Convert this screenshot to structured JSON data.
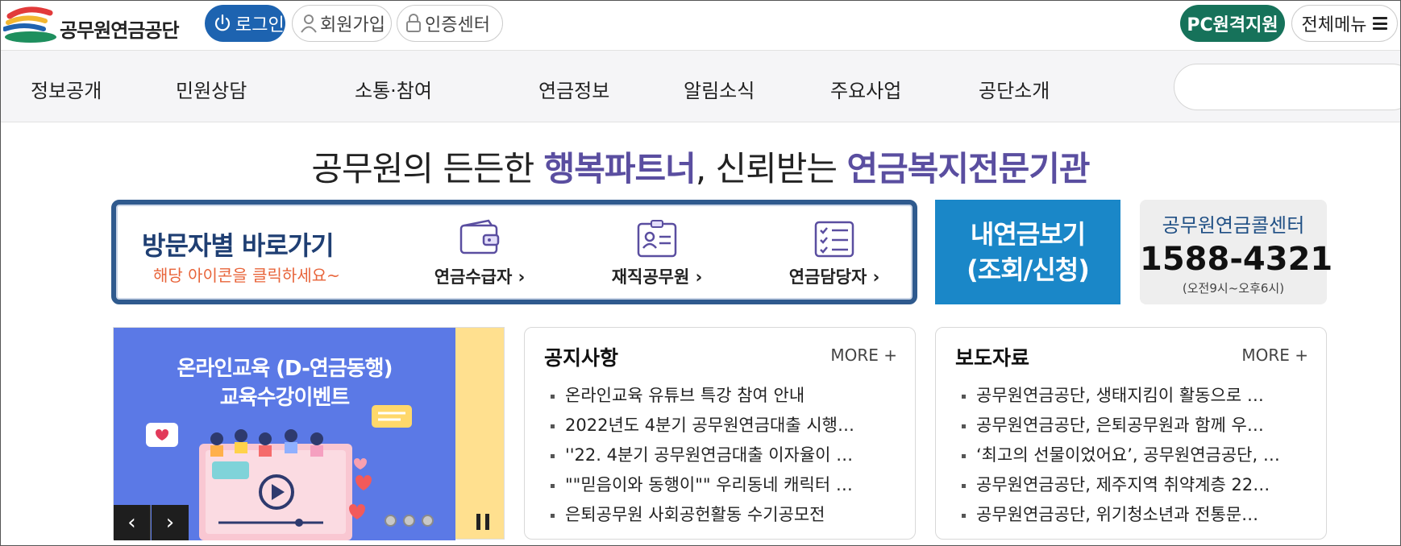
{
  "header": {
    "logo_text": "공무원연금공단",
    "login_label": "로그인",
    "join_label": "회원가입",
    "cert_label": "인증센터",
    "pc_support_label": "PC원격지원",
    "all_menu_label": "전체메뉴"
  },
  "nav": {
    "items": [
      {
        "label": "정보공개"
      },
      {
        "label": "민원상담"
      },
      {
        "label": "소통·참여"
      },
      {
        "label": "연금정보"
      },
      {
        "label": "알림소식"
      },
      {
        "label": "주요사업"
      },
      {
        "label": "공단소개"
      }
    ]
  },
  "slogan": {
    "part1": "공무원의 든든한 ",
    "highlight1": "행복파트너",
    "part2": ", 신뢰받는 ",
    "highlight2": "연금복지전문기관"
  },
  "visitor": {
    "title": "방문자별 바로가기",
    "subtitle": "해당 아이콘을 클릭하세요~",
    "links": [
      {
        "label": "연금수급자",
        "icon": "wallet-icon"
      },
      {
        "label": "재직공무원",
        "icon": "id-card-icon"
      },
      {
        "label": "연금담당자",
        "icon": "checklist-icon"
      }
    ]
  },
  "my_pension": {
    "line1": "내연금보기",
    "line2": "(조회/신청)"
  },
  "call_center": {
    "title": "공무원연금콜센터",
    "number": "1588-4321",
    "hours": "(오전9시~오후6시)"
  },
  "banner": {
    "line1": "온라인교육 (D-연금동행)",
    "line2": "교육수강이벤트",
    "prev_label": "‹",
    "next_label": "›",
    "slide_count": 3
  },
  "notices": {
    "title": "공지사항",
    "more_label": "MORE +",
    "items": [
      "온라인교육 유튜브 특강 참여 안내",
      "2022년도 4분기 공무원연금대출 시행…",
      "''22. 4분기 공무원연금대출 이자율이 …",
      "\"\"믿음이와 동행이\"\" 우리동네 캐릭터 …",
      "은퇴공무원 사회공헌활동 수기공모전"
    ]
  },
  "press": {
    "title": "보도자료",
    "more_label": "MORE +",
    "items": [
      "공무원연금공단, 생태지킴이 활동으로 …",
      "공무원연금공단, 은퇴공무원과 함께 우…",
      "‘최고의 선물이었어요’, 공무원연금공단, …",
      "공무원연금공단, 제주지역 취약계층 22…",
      "공무원연금공단, 위기청소년과 전통문…"
    ]
  },
  "colors": {
    "login_blue": "#1d63b0",
    "pc_green": "#16725a",
    "slogan_purple": "#5a4ea0",
    "visitor_border": "#2f5a8e",
    "my_pension_blue": "#1a87c8",
    "banner_blue": "#5b79e6",
    "banner_yellow": "#ffe08f",
    "subtitle_orange": "#e8643a"
  }
}
